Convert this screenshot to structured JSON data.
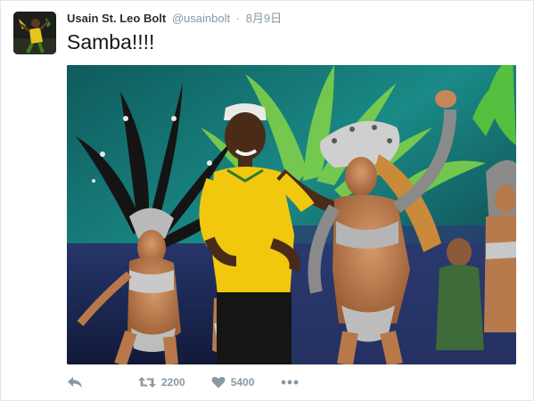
{
  "tweet": {
    "author": {
      "display_name": "Usain St. Leo Bolt",
      "handle": "@usainbolt"
    },
    "separator": "·",
    "timestamp": "8月9日",
    "text": "Samba!!!!",
    "media": {
      "icon": "photo-samba-dancers"
    }
  },
  "actions": {
    "reply_icon": "reply-icon",
    "retweet_count": "2200",
    "like_count": "5400",
    "more_icon": "more-icon"
  },
  "colors": {
    "text": "#292f33",
    "muted": "#8899a6",
    "border": "#e1e8ed"
  }
}
